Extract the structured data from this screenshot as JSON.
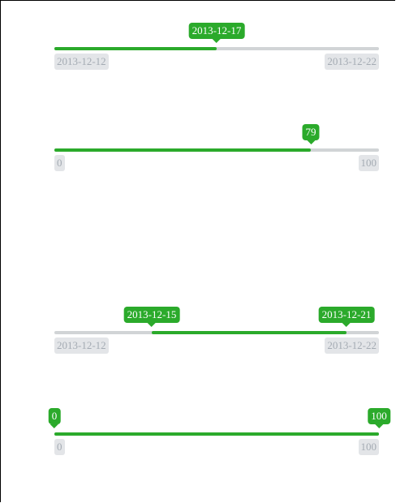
{
  "sliders": [
    {
      "type": "single",
      "floor": "2013-12-12",
      "ceil": "2013-12-22",
      "value_label": "2013-12-17",
      "value_fraction": 0.5
    },
    {
      "type": "single",
      "floor": "0",
      "ceil": "100",
      "value_label": "79",
      "value_fraction": 0.79
    },
    {
      "type": "range",
      "floor": "2013-12-12",
      "ceil": "2013-12-22",
      "low_label": "2013-12-15",
      "high_label": "2013-12-21",
      "low_fraction": 0.3,
      "high_fraction": 0.9
    },
    {
      "type": "range",
      "floor": "0",
      "ceil": "100",
      "low_label": "0",
      "high_label": "100",
      "low_fraction": 0.0,
      "high_fraction": 1.0
    }
  ],
  "colors": {
    "fill": "#2baa2b",
    "track": "#d1d4d6",
    "limit_bg": "#e3e5e8",
    "limit_text": "#a4abb3"
  }
}
